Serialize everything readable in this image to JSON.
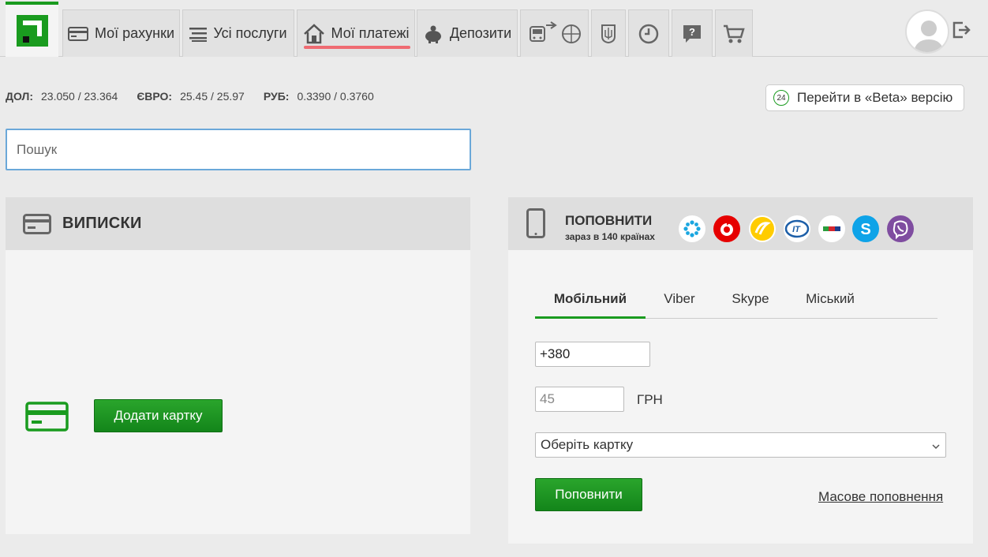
{
  "nav": {
    "tabs": [
      {
        "label": "Мої рахунки",
        "icon": "card-icon"
      },
      {
        "label": "Усі послуги",
        "icon": "list-icon"
      },
      {
        "label": "Мої платежі",
        "icon": "home-icon",
        "active": true
      },
      {
        "label": "Депозити",
        "icon": "piggy-bank-icon"
      }
    ],
    "icon_tabs": [
      "transport-travel-icon",
      "coat-of-arms-icon",
      "history-icon",
      "help-icon",
      "cart-icon"
    ]
  },
  "rates": [
    {
      "name": "ДОЛ:",
      "value": "23.050 / 23.364"
    },
    {
      "name": "ЄВРО:",
      "value": "25.45 / 25.97"
    },
    {
      "name": "РУБ:",
      "value": "0.3390 / 0.3760"
    }
  ],
  "beta": {
    "badge": "24",
    "label": "Перейти в «Beta» версію"
  },
  "search": {
    "placeholder": "Пошук"
  },
  "statements": {
    "title": "ВИПИСКИ",
    "add_card_label": "Додати картку"
  },
  "topup": {
    "title": "ПОПОВНИТИ",
    "subtitle": "зараз в 140 країнах",
    "operators": [
      "kyivstar-icon",
      "vodafone-icon",
      "lifecell-icon",
      "intertelecom-icon",
      "peoplenet-icon",
      "skype-icon",
      "viber-icon"
    ],
    "tabs": [
      "Мобільний",
      "Viber",
      "Skype",
      "Міський"
    ],
    "active_tab": "Мобільний",
    "phone_value": "+380",
    "amount_placeholder": "45",
    "currency": "ГРН",
    "card_select": "Оберіть картку",
    "submit_label": "Поповнити",
    "mass_link": "Масове поповнення"
  },
  "colors": {
    "accent": "#1a9b1f",
    "active_underline": "#ef6b72",
    "search_border": "#6ba8d9"
  }
}
